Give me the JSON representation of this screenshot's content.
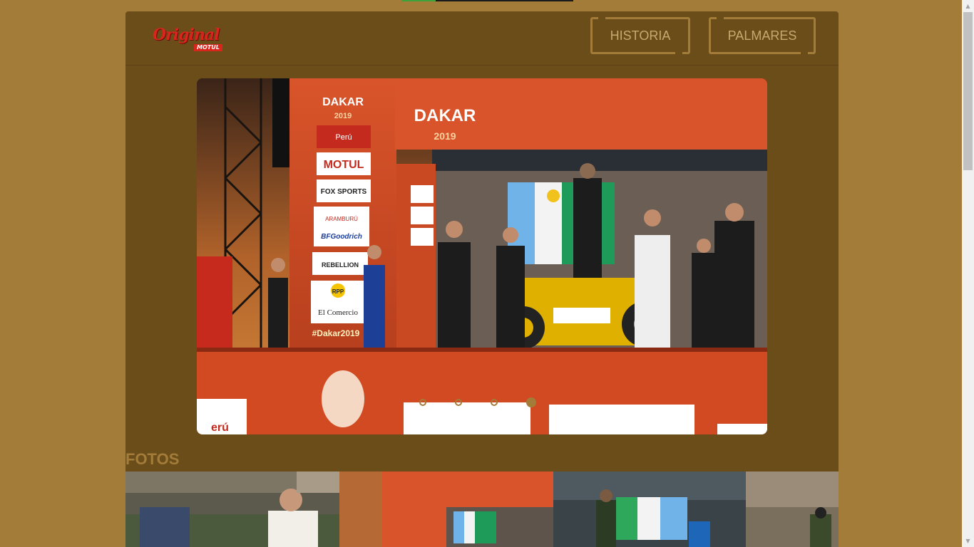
{
  "progress": {
    "fraction": 0.2
  },
  "header": {
    "logo_text_top": "Original",
    "logo_text_bottom": "MOTUL",
    "nav": [
      {
        "label": "HISTORIA"
      },
      {
        "label": "PALMARES"
      }
    ]
  },
  "carousel": {
    "slide_count": 4,
    "active_index": 3,
    "current_slide": {
      "backdrop_text": "DAKAR 2019",
      "sponsors": [
        "Perú",
        "MOTUL",
        "FOX SPORTS",
        "ARAMBURÚ",
        "BFGoodrich",
        "REBELLION",
        "RPP",
        "El Comercio",
        "#Dakar2019"
      ]
    }
  },
  "fotos": {
    "title": "FOTOS"
  },
  "colors": {
    "page_bg": "#a47c39",
    "panel_bg": "#6b4d1a",
    "accent": "#a47c39",
    "dakar_orange": "#d9542a"
  }
}
